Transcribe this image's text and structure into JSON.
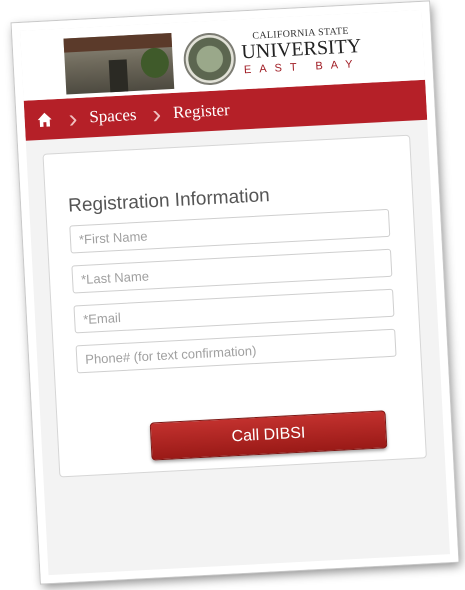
{
  "header": {
    "logo_line1": "CALIFORNIA STATE",
    "logo_line2": "UNIVERSITY",
    "logo_line3": "EAST BAY"
  },
  "breadcrumb": {
    "home_icon": "home-icon",
    "items": [
      {
        "label": "Spaces"
      },
      {
        "label": "Register"
      }
    ]
  },
  "form": {
    "title": "Registration Information",
    "fields": [
      {
        "placeholder": "*First Name",
        "value": ""
      },
      {
        "placeholder": "*Last Name",
        "value": ""
      },
      {
        "placeholder": "*Email",
        "value": ""
      },
      {
        "placeholder": "Phone# (for text confirmation)",
        "value": ""
      }
    ],
    "submit_label": "Call DIBSI"
  },
  "colors": {
    "brand_red": "#b52028",
    "button_red": "#a91f1c"
  }
}
